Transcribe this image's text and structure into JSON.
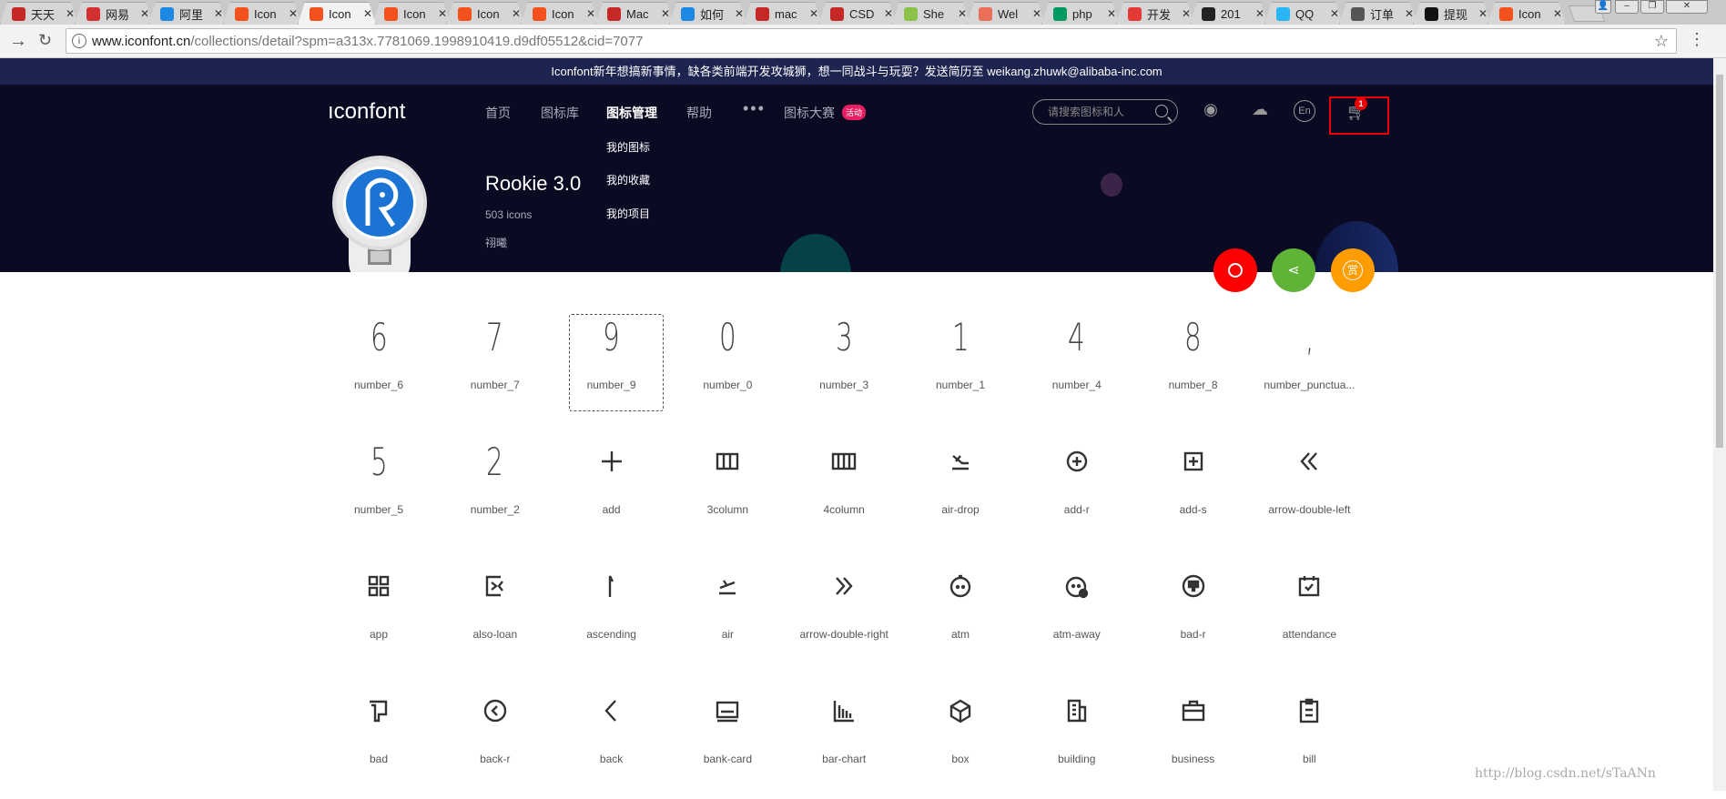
{
  "browser": {
    "tabs": [
      {
        "label": "天天",
        "icon": "tiantian-icon",
        "color": "#c62828",
        "active": false
      },
      {
        "label": "网易",
        "icon": "netease-icon",
        "color": "#d32f2f",
        "active": false
      },
      {
        "label": "阿里",
        "icon": "zhihu-icon",
        "color": "#1e88e5",
        "active": false
      },
      {
        "label": "Icon",
        "icon": "iconfont-icon",
        "color": "#f4511e",
        "active": false
      },
      {
        "label": "Icon",
        "icon": "iconfont-icon",
        "color": "#f4511e",
        "active": true
      },
      {
        "label": "Icon",
        "icon": "iconfont-icon",
        "color": "#f4511e",
        "active": false
      },
      {
        "label": "Icon",
        "icon": "iconfont-icon",
        "color": "#f4511e",
        "active": false
      },
      {
        "label": "Icon",
        "icon": "iconfont-icon",
        "color": "#f4511e",
        "active": false
      },
      {
        "label": "Mac",
        "icon": "csdn-icon",
        "color": "#c62828",
        "active": false
      },
      {
        "label": "如何",
        "icon": "zhihu-icon",
        "color": "#1e88e5",
        "active": false
      },
      {
        "label": "mac",
        "icon": "csdn-icon",
        "color": "#c62828",
        "active": false
      },
      {
        "label": "CSD",
        "icon": "csdn-icon",
        "color": "#c62828",
        "active": false
      },
      {
        "label": "She",
        "icon": "shell-icon",
        "color": "#8bc34a",
        "active": false
      },
      {
        "label": "Wel",
        "icon": "jianshu-icon",
        "color": "#ea6f5a",
        "active": false
      },
      {
        "label": "php",
        "icon": "segmentfault-icon",
        "color": "#009a61",
        "active": false
      },
      {
        "label": "开发",
        "icon": "dev-icon",
        "color": "#e53935",
        "active": false
      },
      {
        "label": "201",
        "icon": "github-icon",
        "color": "#222222",
        "active": false
      },
      {
        "label": "QQ",
        "icon": "qq-icon",
        "color": "#29b6f6",
        "active": false
      },
      {
        "label": "订单",
        "icon": "apple-icon",
        "color": "#555555",
        "active": false
      },
      {
        "label": "提现",
        "icon": "ws-icon",
        "color": "#111111",
        "active": false
      },
      {
        "label": "Icon",
        "icon": "iconfont-icon",
        "color": "#f4511e",
        "active": false
      }
    ],
    "url_host": "www.iconfont.cn",
    "url_path": "/collections/detail?spm=a313x.7781069.1998910419.d9df05512&cid=7077"
  },
  "banner": "Iconfont新年想搞新事情，缺各类前端开发攻城狮，想一同战斗与玩耍？发送简历至 weikang.zhuwk@alibaba-inc.com",
  "header": {
    "logo": "ıconfont",
    "nav": [
      "首页",
      "图标库",
      "图标管理",
      "帮助"
    ],
    "contest": "图标大赛",
    "contest_badge": "活动",
    "search_placeholder": "请搜索图标和人",
    "cart_count": "1",
    "dropdown": [
      "我的图标",
      "我的收藏",
      "我的项目"
    ]
  },
  "collection": {
    "title": "Rookie 3.0",
    "count": "503 icons",
    "author": "祤曦"
  },
  "fab": {
    "search_color": "#ff0000",
    "share_color": "#5fb336",
    "reward_color": "#ff9c00",
    "reward_label": "赏"
  },
  "icons": [
    {
      "name": "number_6",
      "glyph": "6"
    },
    {
      "name": "number_7",
      "glyph": "7"
    },
    {
      "name": "number_9",
      "glyph": "9",
      "selected": true
    },
    {
      "name": "number_0",
      "glyph": "0"
    },
    {
      "name": "number_3",
      "glyph": "3"
    },
    {
      "name": "number_1",
      "glyph": "1"
    },
    {
      "name": "number_4",
      "glyph": "4"
    },
    {
      "name": "number_8",
      "glyph": "8"
    },
    {
      "name": "number_punctua...",
      "glyph": ","
    },
    {
      "name": "number_5",
      "glyph": "5"
    },
    {
      "name": "number_2",
      "glyph": "2"
    },
    {
      "name": "add",
      "glyph": "+"
    },
    {
      "name": "3column",
      "glyph": "3col"
    },
    {
      "name": "4column",
      "glyph": "4col"
    },
    {
      "name": "air-drop",
      "glyph": "airdrop"
    },
    {
      "name": "add-r",
      "glyph": "addr"
    },
    {
      "name": "add-s",
      "glyph": "adds"
    },
    {
      "name": "arrow-double-left",
      "glyph": "«"
    },
    {
      "name": "app",
      "glyph": "app"
    },
    {
      "name": "also-loan",
      "glyph": "loan"
    },
    {
      "name": "ascending",
      "glyph": "asc"
    },
    {
      "name": "air",
      "glyph": "air"
    },
    {
      "name": "arrow-double-right",
      "glyph": "»"
    },
    {
      "name": "atm",
      "glyph": "atm"
    },
    {
      "name": "atm-away",
      "glyph": "atmaway"
    },
    {
      "name": "bad-r",
      "glyph": "badr"
    },
    {
      "name": "attendance",
      "glyph": "att"
    },
    {
      "name": "bad",
      "glyph": "bad"
    },
    {
      "name": "back-r",
      "glyph": "backr"
    },
    {
      "name": "back",
      "glyph": "back"
    },
    {
      "name": "bank-card",
      "glyph": "card"
    },
    {
      "name": "bar-chart",
      "glyph": "bars"
    },
    {
      "name": "box",
      "glyph": "box"
    },
    {
      "name": "building",
      "glyph": "bldg"
    },
    {
      "name": "business",
      "glyph": "biz"
    },
    {
      "name": "bill",
      "glyph": "bill"
    }
  ],
  "watermark": "http://blog.csdn.net/sTaANn"
}
